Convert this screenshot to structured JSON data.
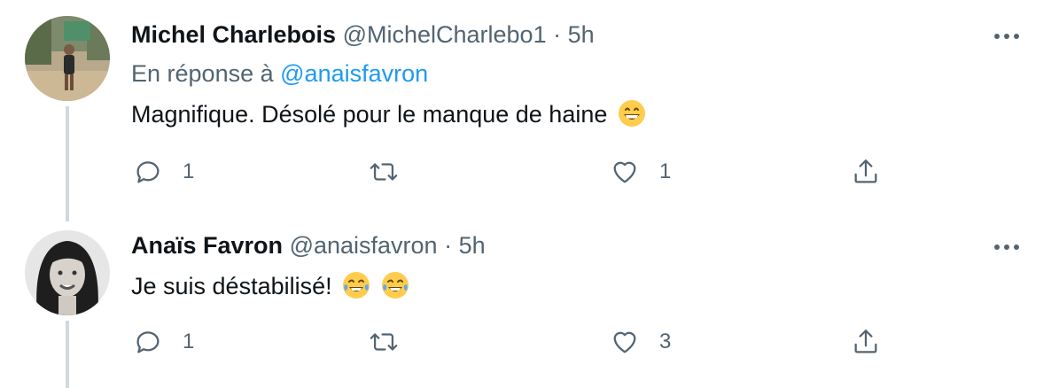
{
  "tweets": [
    {
      "name": "Michel Charlebois",
      "handle": "@MichelCharlebo1",
      "separator": "·",
      "time": "5h",
      "reply_prefix": "En réponse à",
      "reply_mention": "@anaisfavron",
      "text": "Magnifique. Désolé pour le manque de haine",
      "emojis": [
        "grinning-face-emoji"
      ],
      "reply_count": "1",
      "retweet_count": "",
      "like_count": "1"
    },
    {
      "name": "Anaïs Favron",
      "handle": "@anaisfavron",
      "separator": "·",
      "time": "5h",
      "text": "Je suis déstabilisé!",
      "emojis": [
        "tears-of-joy-emoji",
        "tears-of-joy-emoji"
      ],
      "reply_count": "1",
      "retweet_count": "",
      "like_count": "3"
    }
  ],
  "icons": {
    "reply": "reply-icon",
    "retweet": "retweet-icon",
    "like": "heart-icon",
    "share": "share-icon",
    "more": "more-icon"
  },
  "colors": {
    "text": "#0f1419",
    "secondary": "#536471",
    "link": "#1d9bf0",
    "thread_line": "#cfd9de"
  }
}
